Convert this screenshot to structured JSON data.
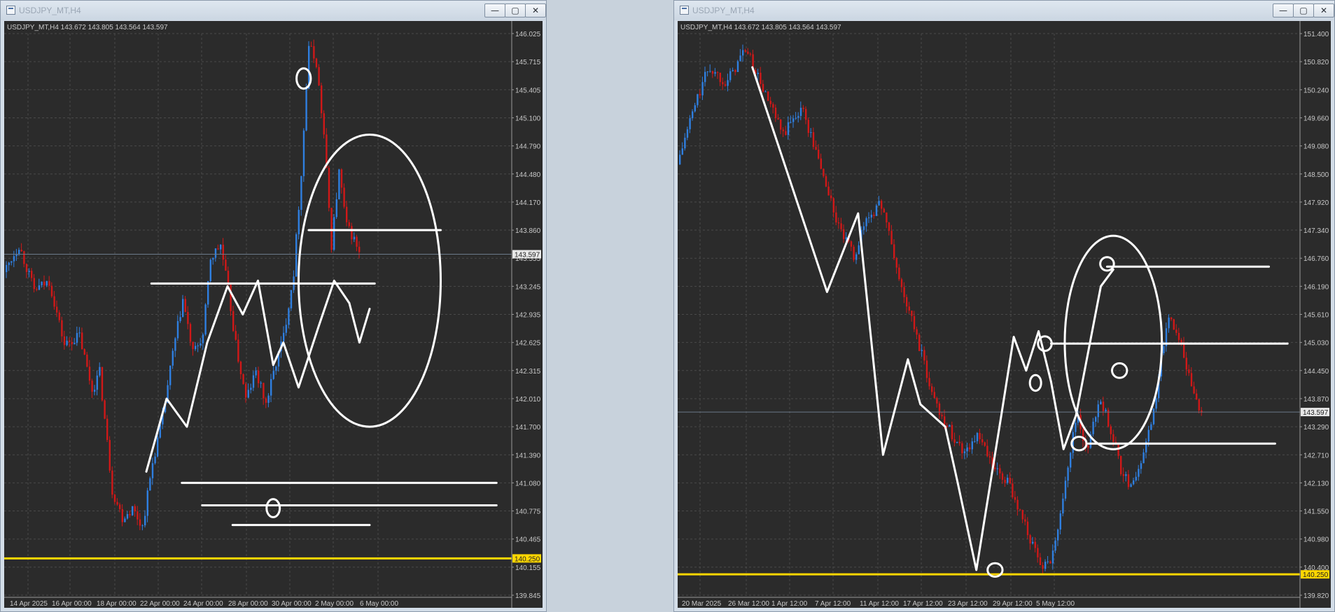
{
  "colors": {
    "background": "#2b2b2b",
    "grid": "#4a4a4a",
    "bull": "#2f7fe0",
    "bear": "#d01818",
    "support": "#ffd700",
    "drawing": "#ffffff",
    "axis_text": "#c8c8c8"
  },
  "icons": {
    "window": "chart-window-icon",
    "minimize": "minimize-icon",
    "maximize": "maximize-icon",
    "close": "close-icon"
  },
  "windows": [
    {
      "title": "USDJPY_MT,H4",
      "buttons": {
        "minimize": "—",
        "maximize": "▢",
        "close": "✕"
      },
      "chart_data": {
        "type": "candlestick",
        "header": "USDJPY_MT,H4  143.672 143.805 143.564 143.597",
        "symbol": "USDJPY_MT",
        "timeframe": "H4",
        "ohlc": {
          "open": 143.672,
          "high": 143.805,
          "low": 143.564,
          "close": 143.597
        },
        "y_ticks": [
          "146.025",
          "145.715",
          "145.405",
          "145.100",
          "144.790",
          "144.480",
          "144.170",
          "143.860",
          "143.555",
          "143.245",
          "142.935",
          "142.625",
          "142.315",
          "142.010",
          "141.700",
          "141.390",
          "141.080",
          "140.775",
          "140.465",
          "140.155",
          "139.845"
        ],
        "ylim": [
          139.845,
          146.025
        ],
        "x_ticks": [
          "14 Apr 2025",
          "16 Apr 00:00",
          "18 Apr 00:00",
          "22 Apr 00:00",
          "24 Apr 00:00",
          "28 Apr 00:00",
          "30 Apr 00:00",
          "2 May 00:00",
          "6 May 00:00"
        ],
        "current_price_label": "143.597",
        "current_price": 143.597,
        "support_label": "140.250",
        "support_price": 140.25,
        "price_path": [
          [
            0.0,
            143.4
          ],
          [
            0.03,
            143.7
          ],
          [
            0.06,
            143.2
          ],
          [
            0.09,
            143.3
          ],
          [
            0.12,
            142.6
          ],
          [
            0.15,
            142.7
          ],
          [
            0.175,
            142.1
          ],
          [
            0.19,
            142.3
          ],
          [
            0.215,
            141.0
          ],
          [
            0.235,
            140.7
          ],
          [
            0.255,
            140.8
          ],
          [
            0.275,
            140.6
          ],
          [
            0.295,
            141.3
          ],
          [
            0.315,
            141.8
          ],
          [
            0.335,
            142.5
          ],
          [
            0.355,
            143.1
          ],
          [
            0.375,
            142.5
          ],
          [
            0.395,
            142.7
          ],
          [
            0.41,
            143.55
          ],
          [
            0.43,
            143.7
          ],
          [
            0.445,
            143.2
          ],
          [
            0.46,
            142.6
          ],
          [
            0.48,
            142.0
          ],
          [
            0.5,
            142.3
          ],
          [
            0.52,
            141.95
          ],
          [
            0.54,
            142.4
          ],
          [
            0.555,
            142.7
          ],
          [
            0.575,
            143.4
          ],
          [
            0.59,
            144.5
          ],
          [
            0.605,
            145.9
          ],
          [
            0.62,
            145.7
          ],
          [
            0.635,
            144.9
          ],
          [
            0.65,
            143.7
          ],
          [
            0.665,
            144.5
          ],
          [
            0.68,
            143.9
          ],
          [
            0.692,
            143.8
          ],
          [
            0.705,
            143.6
          ]
        ]
      }
    },
    {
      "title": "USDJPY_MT,H4",
      "buttons": {
        "minimize": "—",
        "maximize": "▢",
        "close": "✕"
      },
      "chart_data": {
        "type": "candlestick",
        "header": "USDJPY_MT,H4  143.672 143.805 143.564 143.597",
        "symbol": "USDJPY_MT",
        "timeframe": "H4",
        "ohlc": {
          "open": 143.672,
          "high": 143.805,
          "low": 143.564,
          "close": 143.597
        },
        "y_ticks": [
          "151.400",
          "150.820",
          "150.240",
          "149.660",
          "149.080",
          "148.500",
          "147.920",
          "147.340",
          "146.760",
          "146.190",
          "145.610",
          "145.030",
          "144.450",
          "143.870",
          "143.290",
          "142.710",
          "142.130",
          "141.550",
          "140.980",
          "140.400",
          "139.820"
        ],
        "ylim": [
          139.82,
          151.4
        ],
        "x_ticks": [
          "20 Mar 2025",
          "26 Mar 12:00",
          "1 Apr 12:00",
          "7 Apr 12:00",
          "11 Apr 12:00",
          "17 Apr 12:00",
          "23 Apr 12:00",
          "29 Apr 12:00",
          "5 May 12:00"
        ],
        "current_price_label": "143.597",
        "current_price": 143.597,
        "support_label": "140.250",
        "support_price": 140.25,
        "price_path": [
          [
            0.0,
            148.7
          ],
          [
            0.025,
            149.8
          ],
          [
            0.05,
            150.7
          ],
          [
            0.08,
            150.4
          ],
          [
            0.11,
            151.1
          ],
          [
            0.14,
            150.2
          ],
          [
            0.17,
            149.3
          ],
          [
            0.2,
            149.9
          ],
          [
            0.23,
            148.7
          ],
          [
            0.26,
            147.4
          ],
          [
            0.285,
            146.8
          ],
          [
            0.305,
            147.6
          ],
          [
            0.33,
            147.9
          ],
          [
            0.36,
            146.2
          ],
          [
            0.385,
            145.2
          ],
          [
            0.41,
            144.0
          ],
          [
            0.435,
            143.3
          ],
          [
            0.46,
            142.8
          ],
          [
            0.485,
            143.1
          ],
          [
            0.51,
            142.4
          ],
          [
            0.535,
            142.1
          ],
          [
            0.56,
            141.3
          ],
          [
            0.585,
            140.4
          ],
          [
            0.605,
            140.6
          ],
          [
            0.625,
            142.2
          ],
          [
            0.645,
            143.6
          ],
          [
            0.66,
            142.7
          ],
          [
            0.68,
            143.9
          ],
          [
            0.7,
            143.2
          ],
          [
            0.715,
            142.4
          ],
          [
            0.73,
            142.1
          ],
          [
            0.75,
            142.6
          ],
          [
            0.77,
            143.8
          ],
          [
            0.79,
            145.6
          ],
          [
            0.805,
            145.3
          ],
          [
            0.82,
            144.6
          ],
          [
            0.835,
            143.9
          ],
          [
            0.845,
            143.6
          ]
        ]
      }
    }
  ]
}
